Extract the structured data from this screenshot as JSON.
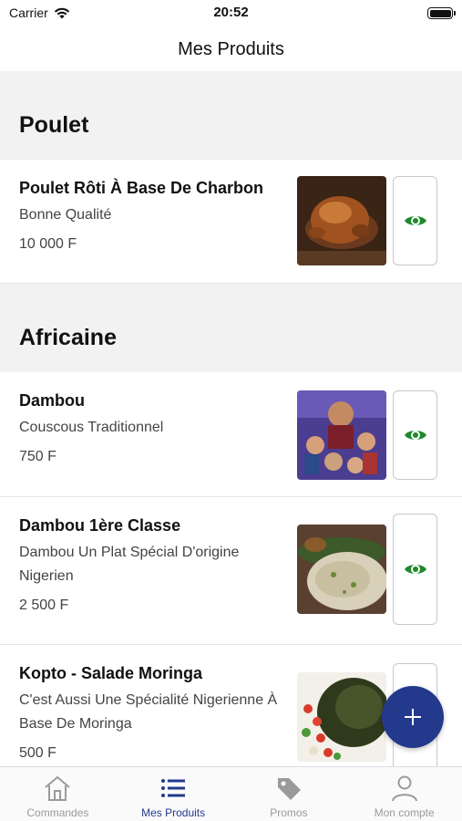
{
  "status_bar": {
    "carrier": "Carrier",
    "time": "20:52"
  },
  "nav": {
    "title": "Mes Produits"
  },
  "sections": [
    {
      "title": "Poulet",
      "items": [
        {
          "name": "Poulet Rôti À Base De Charbon",
          "description": "Bonne Qualité",
          "price": "10 000 F",
          "image": "roast-chicken-photo"
        }
      ]
    },
    {
      "title": "Africaine",
      "items": [
        {
          "name": "Dambou",
          "description": "Couscous Traditionnel",
          "price": "750 F",
          "image": "illustrated-poster-image"
        },
        {
          "name": "Dambou 1ère Classe",
          "description": "Dambou Un Plat Spécial D'origine Nigerien",
          "price": "2 500 F",
          "image": "couscous-plate-photo"
        },
        {
          "name": "Kopto - Salade Moringa",
          "description": "C'est Aussi Une Spécialité Nigerienne À Base De Moringa",
          "price": "500 F",
          "image": "moringa-salad-photo"
        }
      ]
    }
  ],
  "fab": {
    "icon": "plus-icon"
  },
  "tabs": [
    {
      "label": "Commandes",
      "icon": "house-icon",
      "active": false
    },
    {
      "label": "Mes Produits",
      "icon": "list-icon",
      "active": true
    },
    {
      "label": "Promos",
      "icon": "tag-icon",
      "active": false
    },
    {
      "label": "Mon compte",
      "icon": "user-icon",
      "active": false
    }
  ],
  "colors": {
    "accent": "#23398c",
    "eye": "#1e8a2a",
    "section_bg": "#f2f2f2",
    "inactive_tab": "#9a9a9a"
  }
}
